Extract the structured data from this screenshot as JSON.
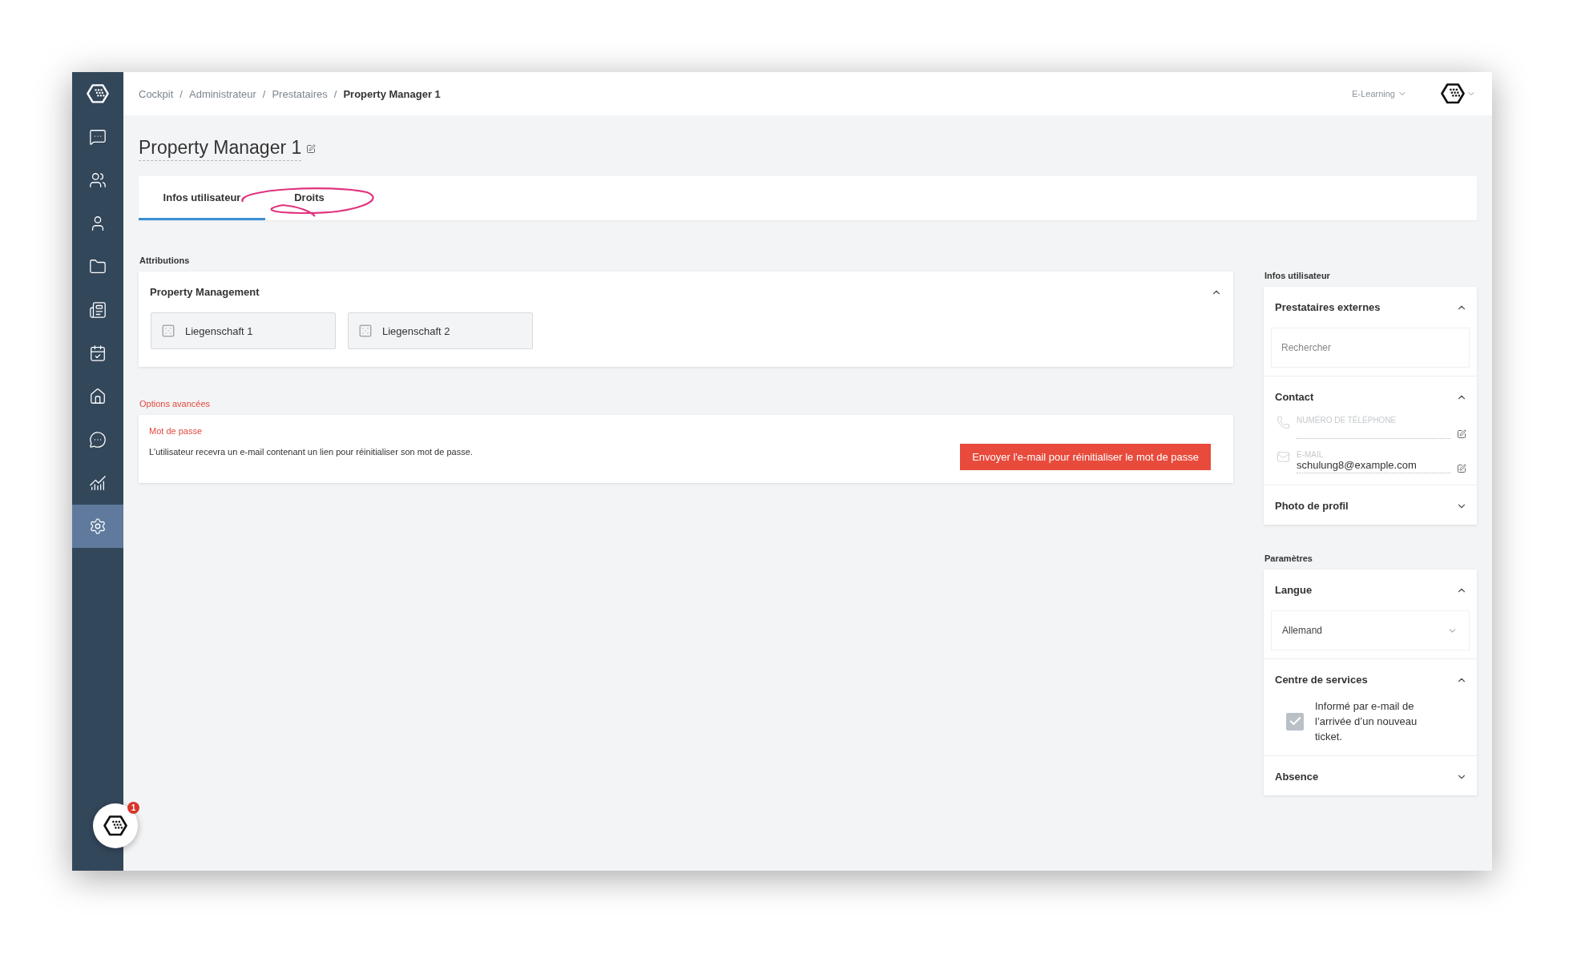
{
  "breadcrumb_separator": "/",
  "breadcrumb": [
    {
      "label": "Cockpit",
      "current": false
    },
    {
      "label": "Administrateur",
      "current": false
    },
    {
      "label": "Prestataires",
      "current": false
    },
    {
      "label": "Property Manager 1",
      "current": true
    }
  ],
  "header": {
    "menu": "E-Learning"
  },
  "sidebar": {
    "items": [
      {
        "selected": false
      },
      {
        "selected": false
      },
      {
        "selected": false
      },
      {
        "selected": false
      },
      {
        "selected": false
      },
      {
        "selected": false
      },
      {
        "selected": false
      },
      {
        "selected": false
      },
      {
        "selected": false
      },
      {
        "selected": true
      }
    ],
    "chat_badge": "1"
  },
  "page_title": "Property Manager 1",
  "tabs": [
    {
      "label": "Infos utilisateur",
      "selected": true
    },
    {
      "label": "Droits",
      "selected": false
    }
  ],
  "attributions": {
    "heading": "Attributions",
    "group": {
      "title": "Property Management",
      "expanded": true,
      "items": [
        "Liegenschaft 1",
        "Liegenschaft 2"
      ]
    }
  },
  "advanced": {
    "heading": "Options avancées",
    "subheading": "Mot de passe",
    "text": "L'utilisateur recevra un e-mail contenant un lien pour réinitialiser son mot de passe.",
    "button": "Envoyer l'e-mail pour réinitialiser le mot de passe"
  },
  "side_panels": [
    {
      "heading": "Infos utilisateur",
      "sections": [
        {
          "kind": "search",
          "title": "Prestataires externes",
          "expanded": true,
          "placeholder": "Rechercher"
        },
        {
          "kind": "contact",
          "title": "Contact",
          "expanded": true,
          "fields": [
            {
              "kind": "phone",
              "label": "NUMÉRO DE TÉLÉPHONE"
            },
            {
              "kind": "email",
              "label": "E-MAIL",
              "value": "schulung8@example.com"
            }
          ]
        },
        {
          "title": "Photo de profil",
          "expanded": false
        }
      ]
    },
    {
      "heading": "Paramètres",
      "sections": [
        {
          "kind": "select",
          "title": "Langue",
          "expanded": true,
          "value": "Allemand"
        },
        {
          "kind": "checkbox",
          "title": "Centre de services",
          "expanded": true,
          "label": "Informé par e-mail de l’arrivée d’un nouveau ticket.",
          "checked": true
        },
        {
          "title": "Absence",
          "expanded": false
        }
      ]
    }
  ]
}
